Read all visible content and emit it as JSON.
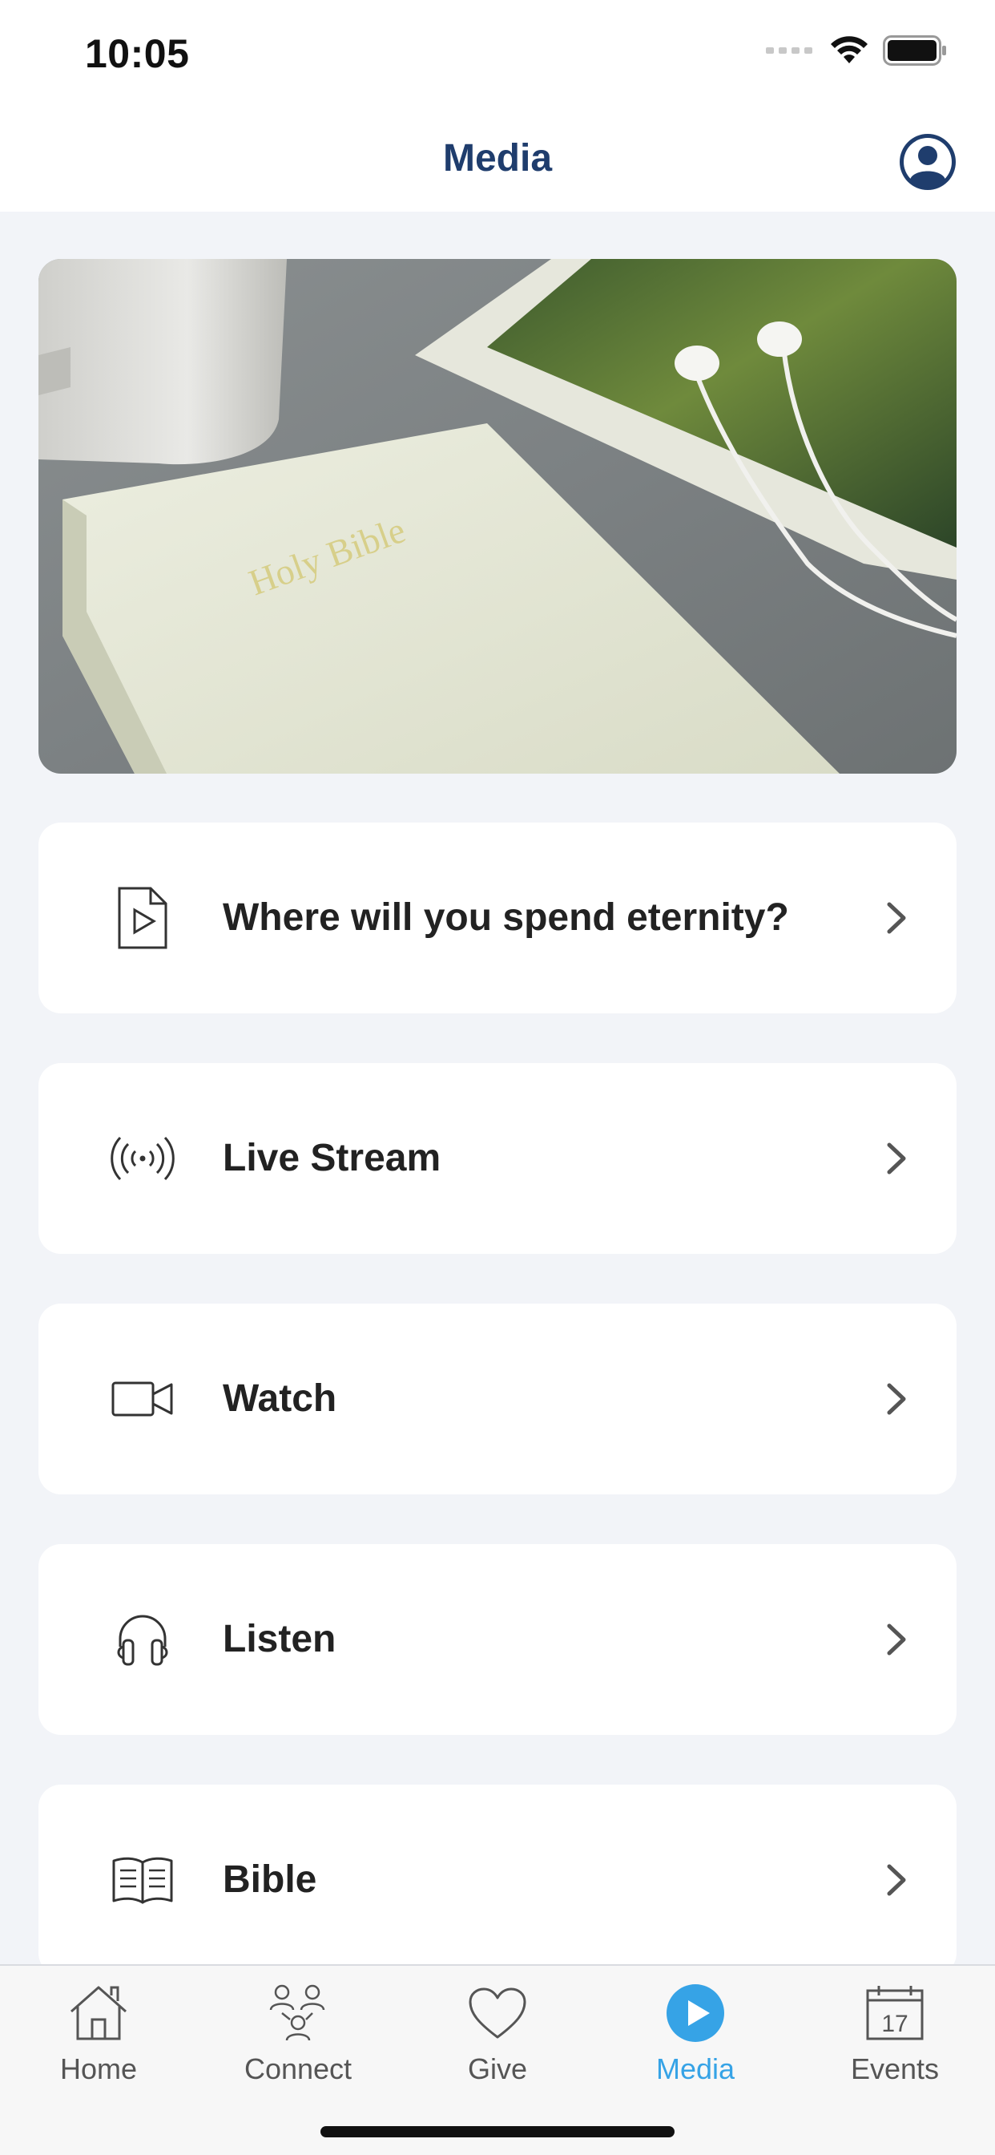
{
  "status_bar": {
    "time": "10:05"
  },
  "header": {
    "title": "Media"
  },
  "hero": {
    "cover_text": "Holy Bible"
  },
  "menu": [
    {
      "label": "Where will you spend eternity?",
      "icon": "document-play-icon"
    },
    {
      "label": "Live Stream",
      "icon": "broadcast-icon"
    },
    {
      "label": "Watch",
      "icon": "video-camera-icon"
    },
    {
      "label": "Listen",
      "icon": "headphones-icon"
    },
    {
      "label": "Bible",
      "icon": "open-book-icon"
    }
  ],
  "tab_bar": {
    "active_tab": "Media",
    "active_color": "#36a3e6",
    "tabs": [
      {
        "label": "Home",
        "icon": "home-icon"
      },
      {
        "label": "Connect",
        "icon": "people-icon"
      },
      {
        "label": "Give",
        "icon": "heart-icon"
      },
      {
        "label": "Media",
        "icon": "play-circle-icon"
      },
      {
        "label": "Events",
        "icon": "calendar-icon",
        "date": "17"
      }
    ]
  }
}
